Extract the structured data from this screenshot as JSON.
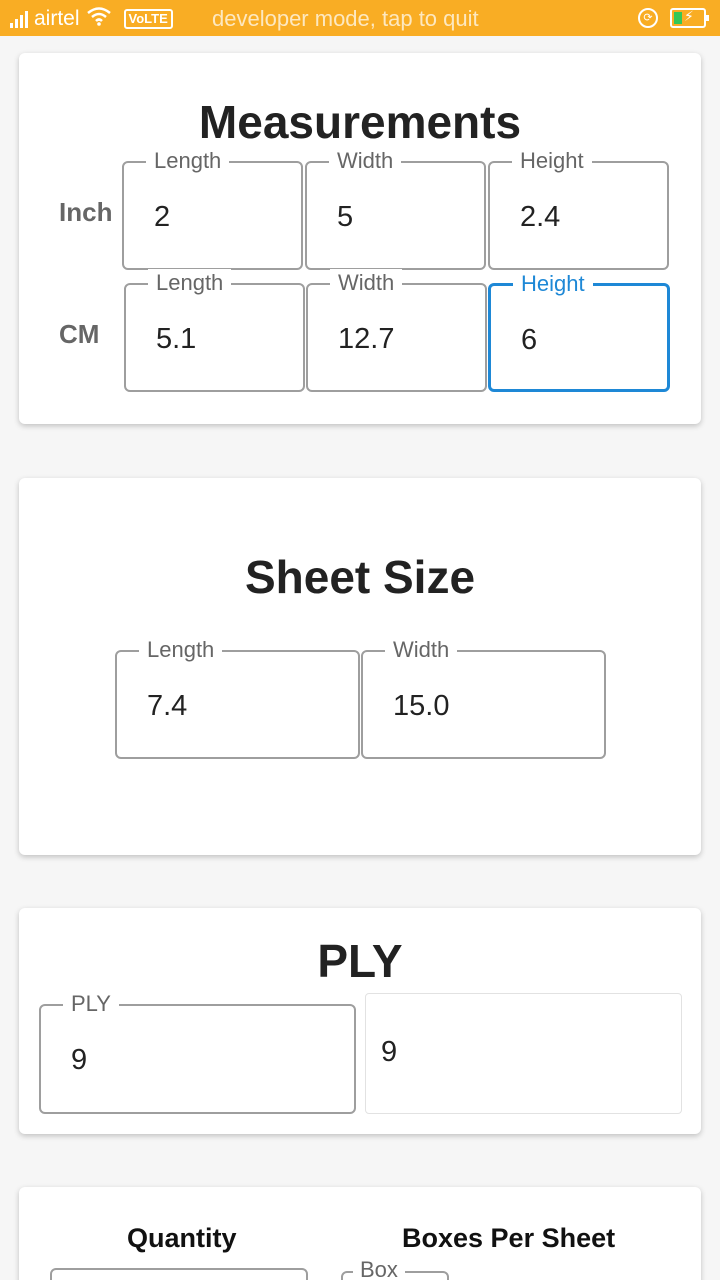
{
  "status_bar": {
    "carrier": "airtel",
    "volte": "VoLTE",
    "notice": "developer mode, tap to quit",
    "icons": [
      "signal-icon",
      "wifi-icon",
      "rotation-lock-icon",
      "battery-charging-icon"
    ]
  },
  "measurements": {
    "title": "Measurements",
    "inch": {
      "label": "Inch",
      "length": {
        "legend": "Length",
        "value": "2"
      },
      "width": {
        "legend": "Width",
        "value": "5"
      },
      "height": {
        "legend": "Height",
        "value": "2.4"
      }
    },
    "cm": {
      "label": "CM",
      "length": {
        "legend": "Length",
        "value": "5.1"
      },
      "width": {
        "legend": "Width",
        "value": "12.7"
      },
      "height": {
        "legend": "Height",
        "value": "6"
      }
    }
  },
  "sheet_size": {
    "title": "Sheet Size",
    "length": {
      "legend": "Length",
      "value": "7.4"
    },
    "width": {
      "legend": "Width",
      "value": "15.0"
    }
  },
  "ply": {
    "title": "PLY",
    "field": {
      "legend": "PLY",
      "value": "9"
    },
    "display_value": "9"
  },
  "quantity_section": {
    "quantity_label": "Quantity",
    "boxes_per_sheet_label": "Boxes Per Sheet",
    "box_legend": "Box"
  },
  "colors": {
    "status_bar": "#f9ad24",
    "focus": "#1e88d6"
  }
}
